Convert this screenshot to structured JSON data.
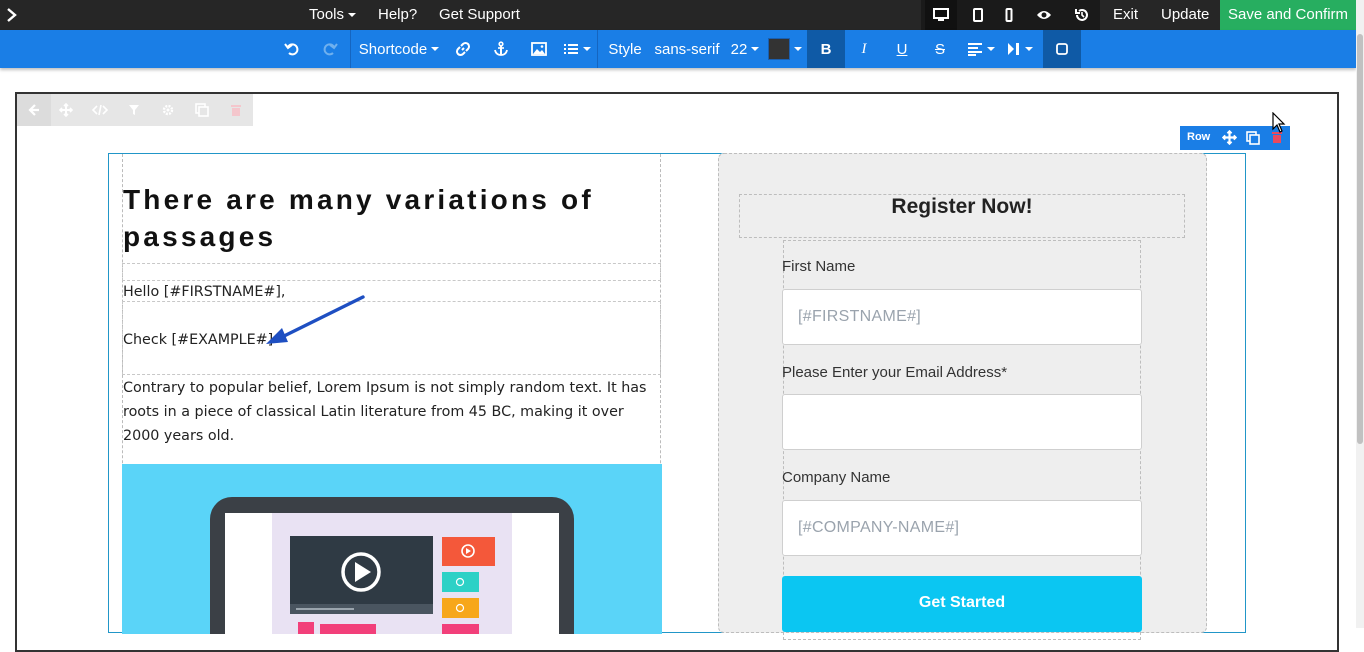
{
  "topbar": {
    "tools_label": "Tools",
    "help_label": "Help?",
    "support_label": "Get Support",
    "exit_label": "Exit",
    "update_label": "Update",
    "save_label": "Save and Confirm",
    "colors": {
      "background": "#262626",
      "save": "#27ae60"
    }
  },
  "toolbar": {
    "shortcode_label": "Shortcode",
    "style_label": "Style",
    "font_family": "sans-serif",
    "font_size": "22",
    "bold_label": "B",
    "italic_label": "I",
    "underline_label": "U",
    "strike_label": "S",
    "text_color": "#333333",
    "background": "#1a7ee6"
  },
  "row_tag": {
    "label": "Row"
  },
  "content": {
    "headline": "There are many variations of passages",
    "hello": "Hello [#FIRSTNAME#],",
    "check": "Check [#EXAMPLE#]",
    "paragraph": "Contrary to popular belief, Lorem Ipsum is not simply random text. It has roots in a piece of classical Latin literature from 45 BC, making it over 2000 years old."
  },
  "form": {
    "title": "Register Now!",
    "first_name_label": "First Name",
    "first_name_value": "[#FIRSTNAME#]",
    "email_label": "Please Enter your Email Address*",
    "email_value": "",
    "company_label": "Company Name",
    "company_value": "[#COMPANY-NAME#]",
    "submit_label": "Get Started",
    "submit_color": "#0bc6f2"
  }
}
